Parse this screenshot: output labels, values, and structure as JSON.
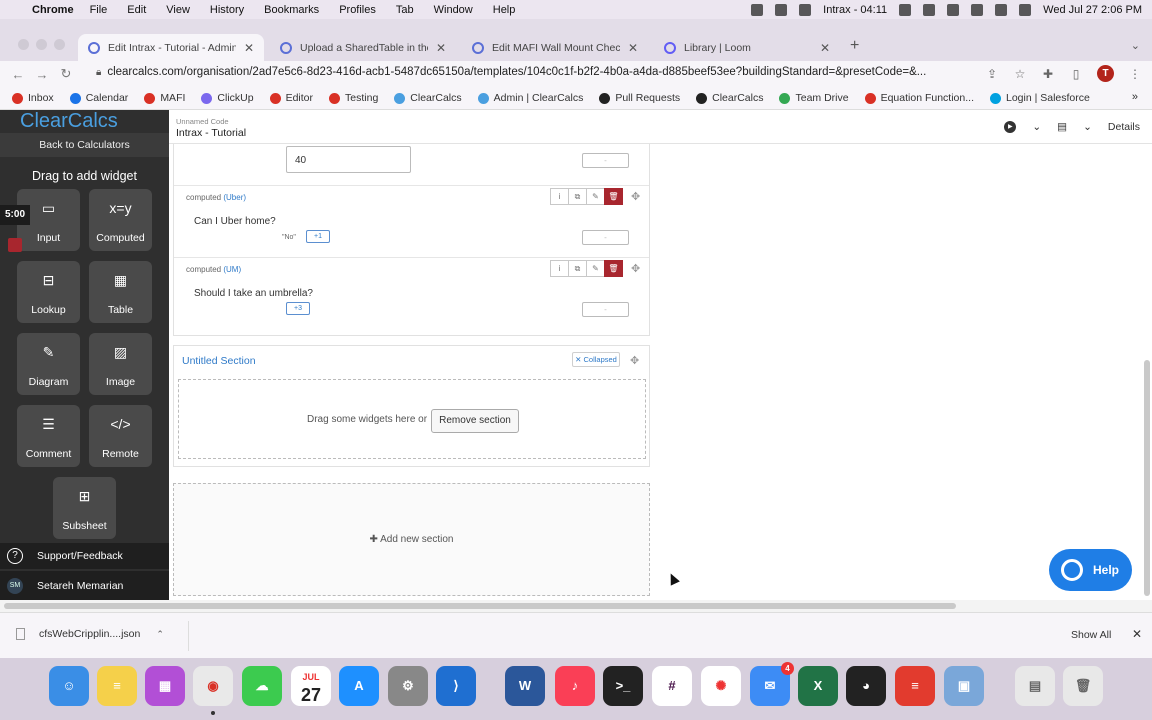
{
  "menubar": {
    "app": "Chrome",
    "items": [
      "File",
      "Edit",
      "View",
      "History",
      "Bookmarks",
      "Profiles",
      "Tab",
      "Window",
      "Help"
    ],
    "status_app": "Intrax - 04:11",
    "datetime": "Wed Jul 27  2:06 PM"
  },
  "tabs": [
    {
      "label": "Edit Intrax - Tutorial - Admin | C"
    },
    {
      "label": "Upload a SharedTable in the Ca"
    },
    {
      "label": "Edit MAFI Wall Mount Checker"
    },
    {
      "label": "Library | Loom"
    }
  ],
  "address": {
    "url": "clearcalcs.com/organisation/2ad7e5c6-8d23-416d-acb1-5487dc65150a/templates/104c0c1f-b2f2-4b0a-a4da-d885beef53ee?buildingStandard=&presetCode=&...",
    "avatar": "T"
  },
  "bookmarks": [
    {
      "label": "Inbox",
      "color": "#d93025"
    },
    {
      "label": "Calendar",
      "color": "#1a73e8"
    },
    {
      "label": "MAFI",
      "color": "#d93025"
    },
    {
      "label": "ClickUp",
      "color": "#7b68ee"
    },
    {
      "label": "Editor",
      "color": "#d93025"
    },
    {
      "label": "Testing",
      "color": "#d93025"
    },
    {
      "label": "ClearCalcs",
      "color": "#4a9fe0"
    },
    {
      "label": "Admin | ClearCalcs",
      "color": "#4a9fe0"
    },
    {
      "label": "Pull Requests",
      "color": "#222222"
    },
    {
      "label": "ClearCalcs",
      "color": "#222222"
    },
    {
      "label": "Team Drive",
      "color": "#34a853"
    },
    {
      "label": "Equation Function...",
      "color": "#d93025"
    },
    {
      "label": "Login | Salesforce",
      "color": "#00a1e0"
    }
  ],
  "sidebar": {
    "logo": "ClearCalcs",
    "back": "Back to Calculators",
    "drag_title": "Drag to add widget",
    "timer": "5:00",
    "widgets": [
      {
        "label": "Input",
        "icon": "input-icon",
        "glyph": "▭"
      },
      {
        "label": "Computed",
        "icon": "formula-icon",
        "glyph": "x=y"
      },
      {
        "label": "Lookup",
        "icon": "lookup-icon",
        "glyph": "⊟"
      },
      {
        "label": "Table",
        "icon": "table-icon",
        "glyph": "▦"
      },
      {
        "label": "Diagram",
        "icon": "diagram-icon",
        "glyph": "✎"
      },
      {
        "label": "Image",
        "icon": "image-icon",
        "glyph": "▨"
      },
      {
        "label": "Comment",
        "icon": "comment-icon",
        "glyph": "☰"
      },
      {
        "label": "Remote",
        "icon": "remote-icon",
        "glyph": "</>"
      },
      {
        "label": "Subsheet",
        "icon": "subsheet-icon",
        "glyph": "⊞"
      }
    ],
    "support": "Support/Feedback",
    "user_initials": "SM",
    "user_name": "Setareh Memarian"
  },
  "app_header": {
    "doc_meta": "Unnamed Code",
    "doc_title": "Intrax - Tutorial",
    "details": "Details"
  },
  "editor": {
    "input_value": "40",
    "result_placeholder": "-",
    "rows": [
      {
        "kind": "computed",
        "symbol": "(Uber)",
        "question": "Can I Uber home?",
        "value": "\"No\"",
        "tag": "+1"
      },
      {
        "kind": "computed",
        "symbol": "(UM)",
        "question": "Should I take an umbrella?",
        "value": "",
        "tag": "+3"
      }
    ],
    "section": {
      "title": "Untitled Section",
      "collapsed": "Collapsed",
      "drop_text": "Drag some widgets here or",
      "remove": "Remove section"
    },
    "add_section": "Add new section"
  },
  "help": {
    "label": "Help"
  },
  "downloads": {
    "file": "cfsWebCripplin....json",
    "show_all": "Show All"
  },
  "dock": {
    "calendar_month": "JUL",
    "calendar_day": "27",
    "mail_badge": "4"
  }
}
